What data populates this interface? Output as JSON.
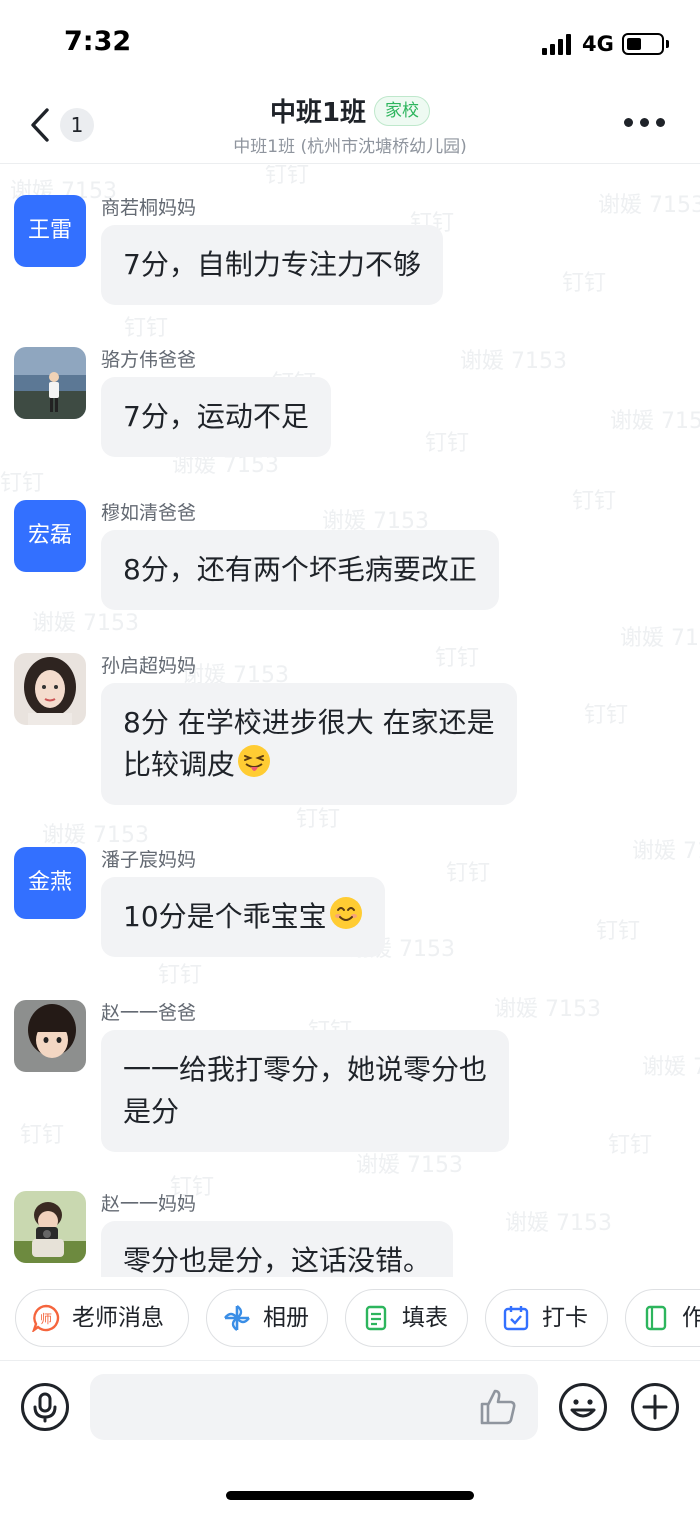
{
  "status_bar": {
    "time": "7:32",
    "network": "4G"
  },
  "header": {
    "back_count": "1",
    "title": "中班1班",
    "tag": "家校",
    "subtitle": "中班1班 (杭州市沈塘桥幼儿园)"
  },
  "watermarks": {
    "user": "谢媛 7153",
    "app": "钉钉"
  },
  "messages": [
    {
      "sender": "商若桐妈妈",
      "avatar_text": "王雷",
      "text": "7分，自制力专注力不够"
    },
    {
      "sender": "骆方伟爸爸",
      "avatar_icon": "photo-seaside-man",
      "text": "7分，运动不足"
    },
    {
      "sender": "穆如清爸爸",
      "avatar_text": "宏磊",
      "text": "8分，还有两个坏毛病要改正"
    },
    {
      "sender": "孙启超妈妈",
      "avatar_icon": "photo-woman",
      "lines": [
        "8分 在学校进步很大 在家还是",
        "比较调皮"
      ],
      "emoji": "tongue-out-emoji"
    },
    {
      "sender": "潘子宸妈妈",
      "avatar_text": "金燕",
      "text": "10分是个乖宝宝",
      "emoji": "smile-emoji"
    },
    {
      "sender": "赵一一爸爸",
      "avatar_icon": "photo-child",
      "lines": [
        "一一给我打零分，她说零分也",
        "是分"
      ]
    },
    {
      "sender": "赵一一妈妈",
      "avatar_icon": "photo-child-photographer",
      "text": "零分也是分，这话没错。"
    }
  ],
  "quick_actions": [
    {
      "label": "老师消息",
      "icon": "teacher-message-icon",
      "color": "#f5653d"
    },
    {
      "label": "相册",
      "icon": "album-icon",
      "color": "#3a8ee6"
    },
    {
      "label": "填表",
      "icon": "form-icon",
      "color": "#2db55d"
    },
    {
      "label": "打卡",
      "icon": "check-in-icon",
      "color": "#3370ff"
    },
    {
      "label": "作",
      "icon": "homework-icon",
      "color": "#2db55d"
    }
  ],
  "input": {
    "placeholder": ""
  },
  "colors": {
    "accent": "#3370ff",
    "bubble": "#f2f3f5",
    "tag_green": "#2db55d"
  }
}
